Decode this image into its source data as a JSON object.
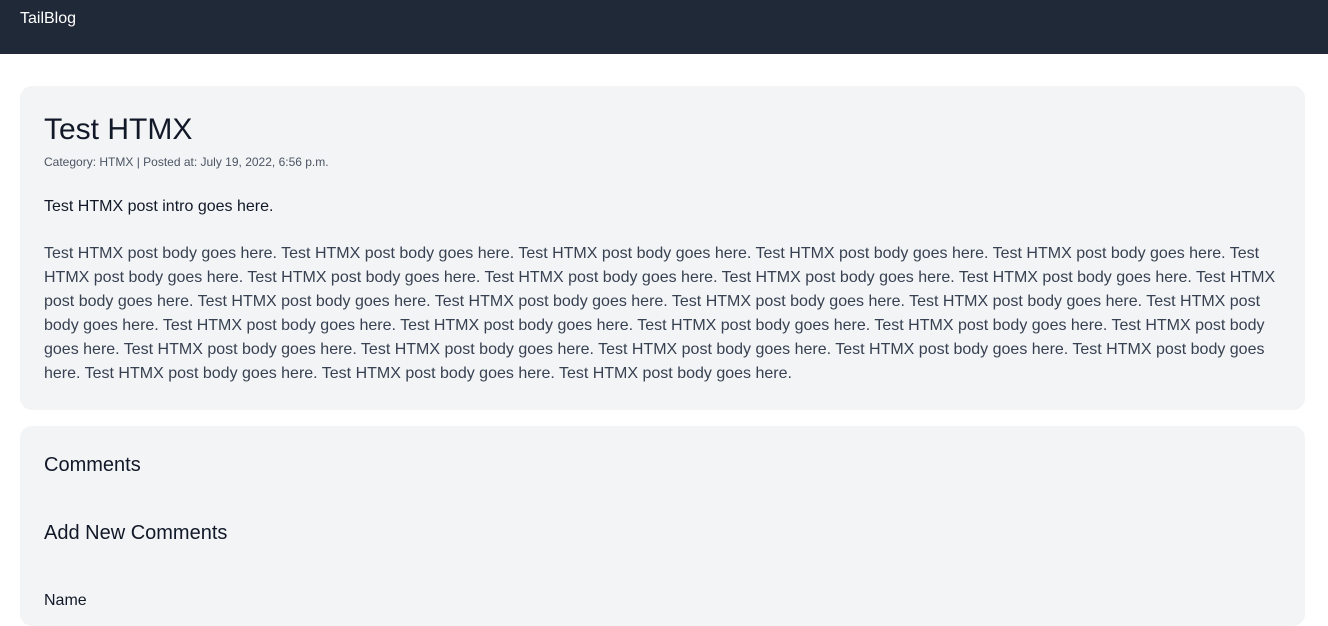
{
  "navbar": {
    "brand": "TailBlog"
  },
  "post": {
    "title": "Test HTMX",
    "meta": "Category: HTMX | Posted at: July 19, 2022, 6:56 p.m.",
    "intro": "Test HTMX post intro goes here.",
    "body": "Test HTMX post body goes here. Test HTMX post body goes here. Test HTMX post body goes here. Test HTMX post body goes here. Test HTMX post body goes here. Test HTMX post body goes here. Test HTMX post body goes here. Test HTMX post body goes here. Test HTMX post body goes here. Test HTMX post body goes here. Test HTMX post body goes here. Test HTMX post body goes here. Test HTMX post body goes here. Test HTMX post body goes here. Test HTMX post body goes here. Test HTMX post body goes here. Test HTMX post body goes here. Test HTMX post body goes here. Test HTMX post body goes here. Test HTMX post body goes here. Test HTMX post body goes here. Test HTMX post body goes here. Test HTMX post body goes here. Test HTMX post body goes here. Test HTMX post body goes here. Test HTMX post body goes here. Test HTMX post body goes here. Test HTMX post body goes here. Test HTMX post body goes here."
  },
  "comments": {
    "heading": "Comments",
    "add_heading": "Add New Comments",
    "name_label": "Name"
  }
}
